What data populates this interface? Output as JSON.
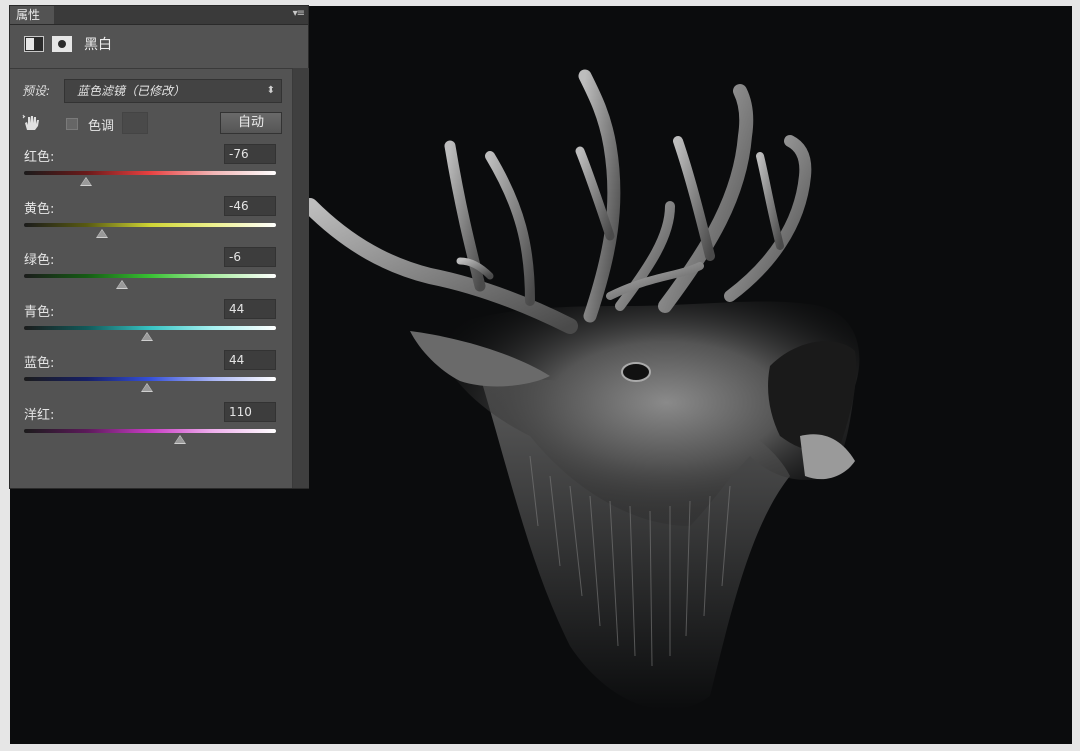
{
  "panel": {
    "tab_label": "属性",
    "menu_icon": "panel-menu-icon",
    "adjustment_title": "黑白",
    "preset_label": "预设:",
    "preset_value": "蓝色滤镜（已修改）",
    "tint_label": "色调",
    "tint_checked": false,
    "auto_button": "自动",
    "sliders": [
      {
        "label": "红色:",
        "value": "-76",
        "level": -76,
        "track": [
          "#1b1b1b",
          "#6b1a1a",
          "#e84141",
          "#f2b5b5",
          "#ffffff"
        ]
      },
      {
        "label": "黄色:",
        "value": "-46",
        "level": -46,
        "track": [
          "#1b1b1b",
          "#585a12",
          "#cfd434",
          "#eef28e",
          "#ffffff"
        ]
      },
      {
        "label": "绿色:",
        "value": "-6",
        "level": -6,
        "track": [
          "#1b1b1b",
          "#155c14",
          "#38c033",
          "#a8eda0",
          "#ffffff"
        ]
      },
      {
        "label": "青色:",
        "value": "44",
        "level": 44,
        "track": [
          "#1b1b1b",
          "#115a5a",
          "#37c3c3",
          "#a6f0f0",
          "#ffffff"
        ]
      },
      {
        "label": "蓝色:",
        "value": "44",
        "level": 44,
        "track": [
          "#1b1b1b",
          "#161f66",
          "#3550d8",
          "#a9b5f5",
          "#ffffff"
        ]
      },
      {
        "label": "洋红:",
        "value": "110",
        "level": 110,
        "track": [
          "#1b1b1b",
          "#5c1a5a",
          "#c83cc4",
          "#efb0ed",
          "#ffffff"
        ]
      }
    ],
    "slider_range": [
      -200,
      300
    ]
  },
  "canvas": {
    "background": "#0b0c0d",
    "subject": "roaring-deer-image"
  }
}
